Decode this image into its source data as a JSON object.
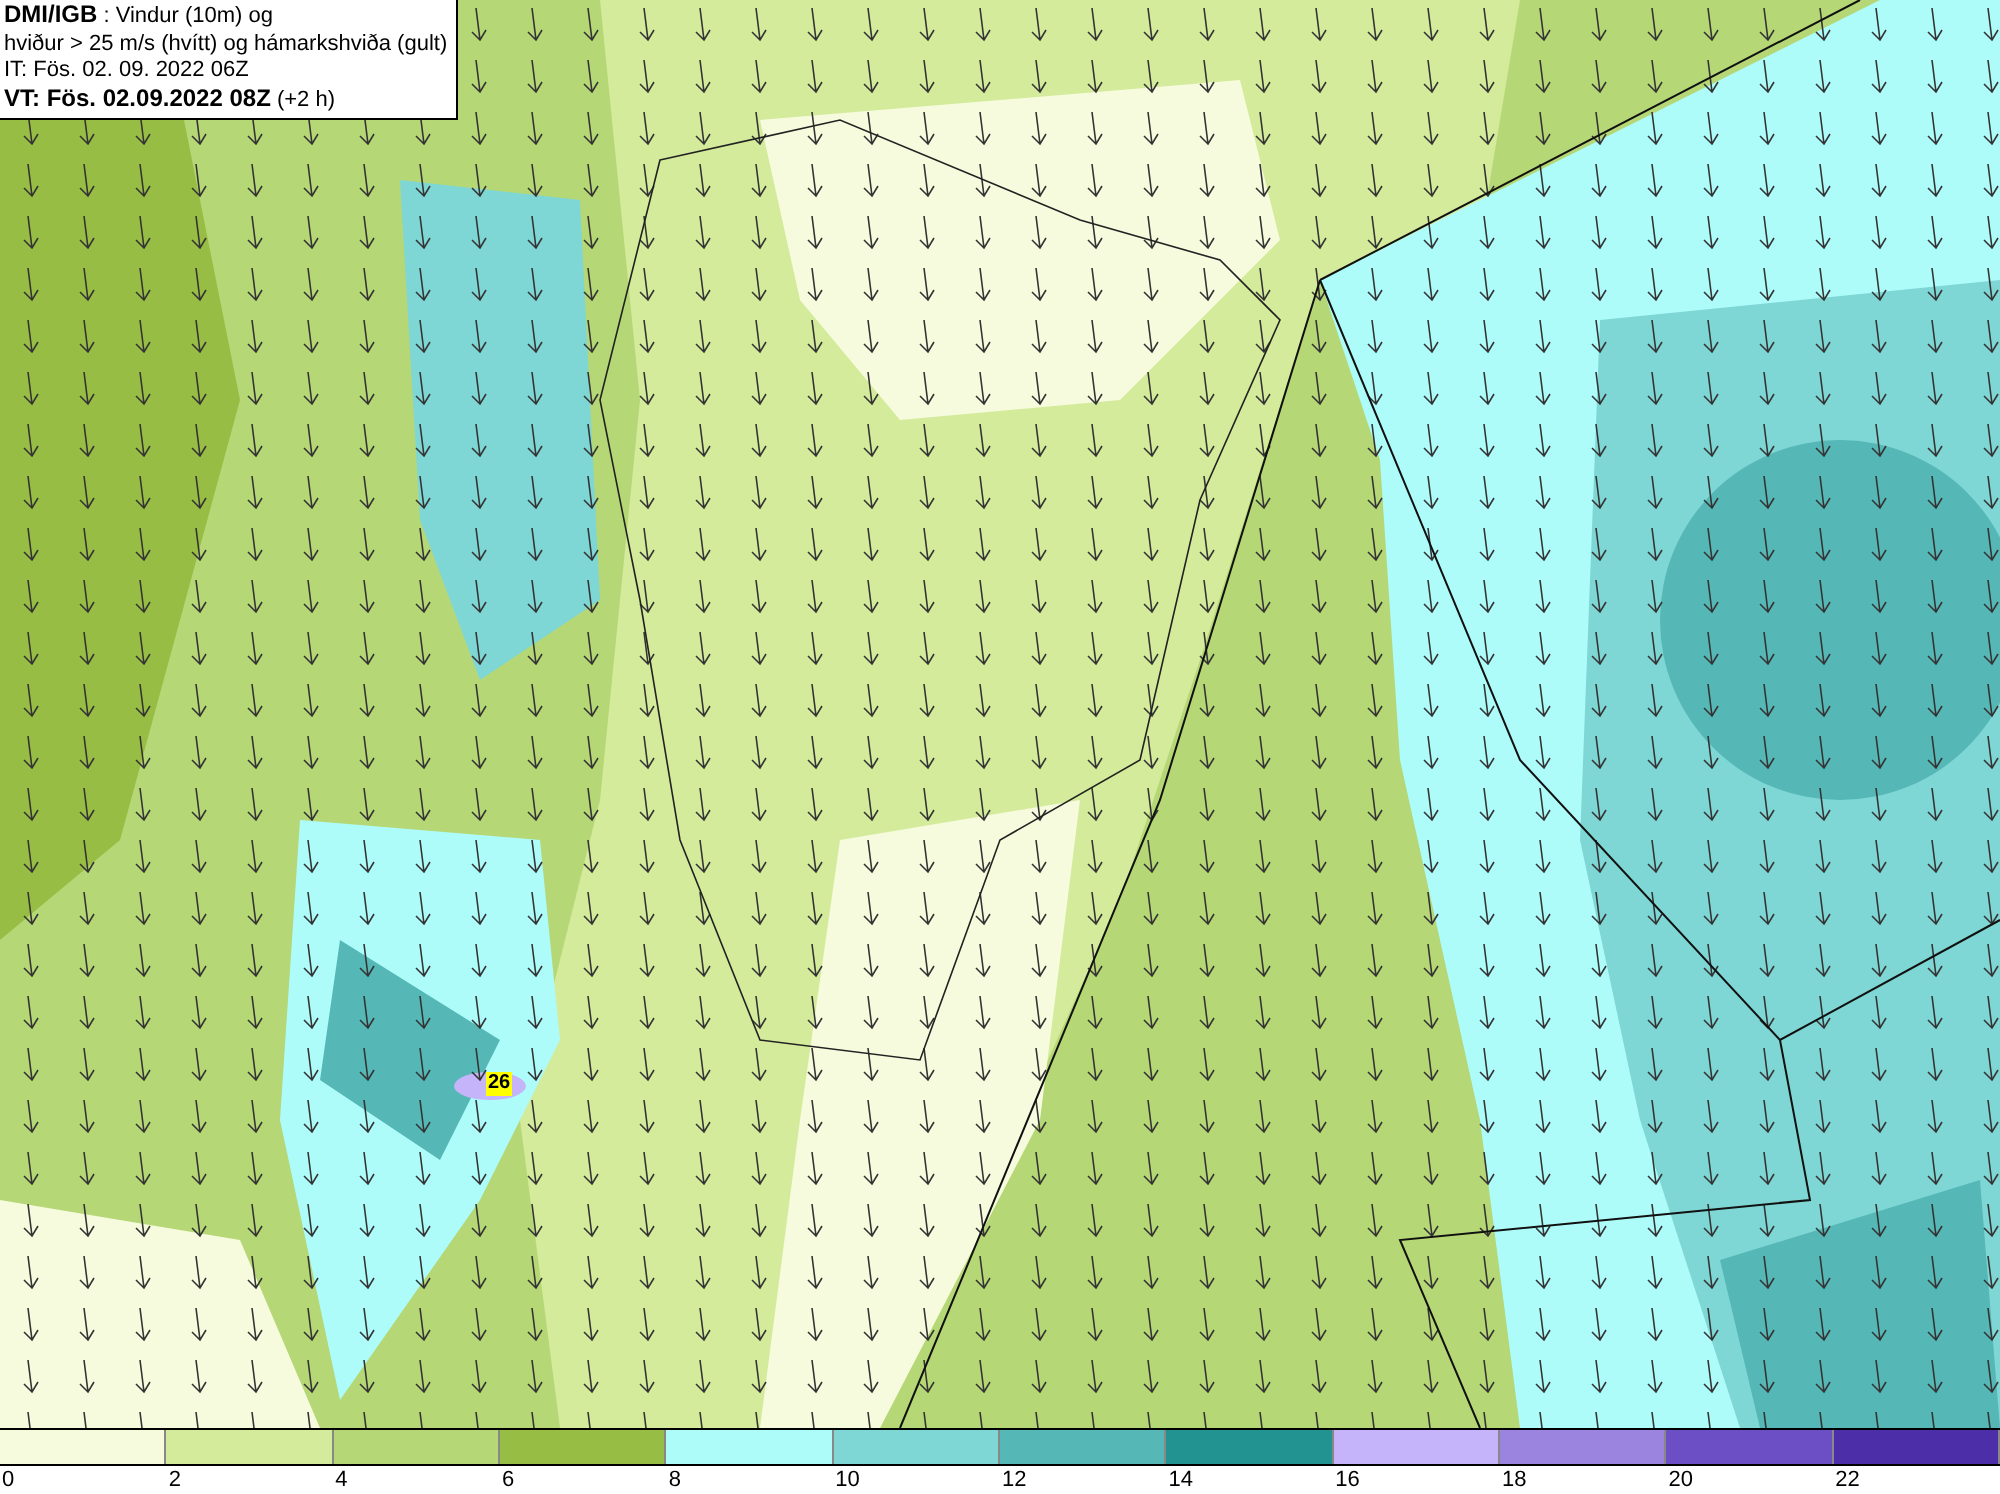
{
  "title_box": {
    "lines": [
      "**DMI/IGB** : Vindur (10m) og",
      "hviður > 25 m/s (hvítt) og hámarkshviða (gult)",
      "IT: Fös. 02. 09. 2022 06Z",
      "**VT: Fös. 02.09.2022 08Z** (+2 h)"
    ]
  },
  "gust_label": "26",
  "legend": {
    "bins": [
      {
        "color": "#f5fbdc"
      },
      {
        "color": "#d4eb9b"
      },
      {
        "color": "#b5d775"
      },
      {
        "color": "#98bd45"
      },
      {
        "color": "#aefcfa"
      },
      {
        "color": "#7fd7d5"
      },
      {
        "color": "#55b8b6"
      },
      {
        "color": "#239392"
      },
      {
        "color": "#c5b4f9"
      },
      {
        "color": "#9b84e0"
      },
      {
        "color": "#6c4fc5"
      },
      {
        "color": "#4b2ea8"
      }
    ],
    "ticks": [
      "0",
      "2",
      "4",
      "6",
      "8",
      "10",
      "12",
      "14",
      "16",
      "18",
      "20",
      "22"
    ]
  }
}
